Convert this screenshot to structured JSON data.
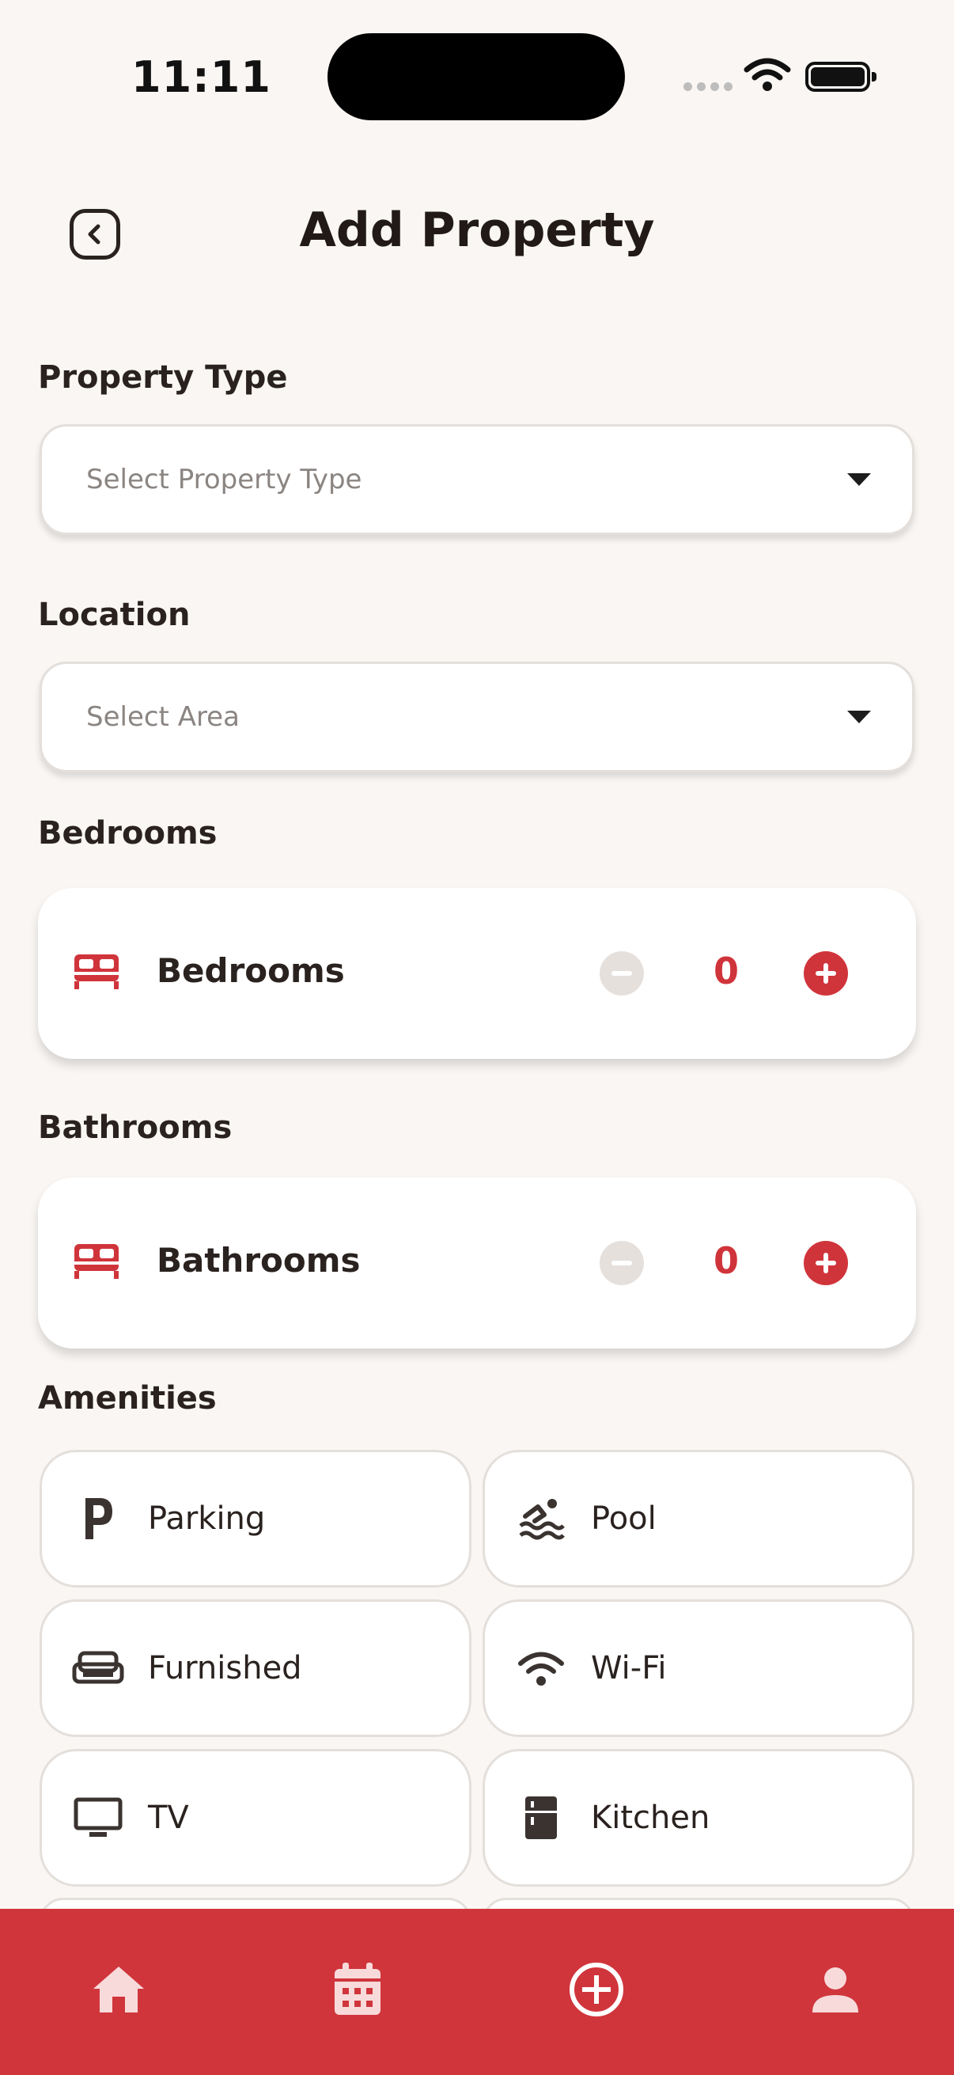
{
  "status_bar": {
    "time": "11:11"
  },
  "header": {
    "title": "Add Property",
    "back_icon": "chevron-left-icon"
  },
  "property_type": {
    "label": "Property Type",
    "placeholder": "Select Property Type"
  },
  "location": {
    "label": "Location",
    "placeholder": "Select Area"
  },
  "bedrooms": {
    "section_label": "Bedrooms",
    "card_label": "Bedrooms",
    "value": "0",
    "icon": "bed-icon"
  },
  "bathrooms": {
    "section_label": "Bathrooms",
    "card_label": "Bathrooms",
    "value": "0",
    "icon": "bed-icon"
  },
  "amenities": {
    "label": "Amenities",
    "items": [
      {
        "label": "Parking",
        "icon": "parking-icon"
      },
      {
        "label": "Pool",
        "icon": "swimming-icon"
      },
      {
        "label": "Furnished",
        "icon": "sofa-icon"
      },
      {
        "label": "Wi-Fi",
        "icon": "wifi-icon"
      },
      {
        "label": "TV",
        "icon": "tv-icon"
      },
      {
        "label": "Kitchen",
        "icon": "fridge-icon"
      }
    ]
  },
  "bottom_nav": {
    "items": [
      {
        "icon": "home-icon"
      },
      {
        "icon": "calendar-icon"
      },
      {
        "icon": "add-circle-icon"
      },
      {
        "icon": "profile-icon"
      }
    ]
  },
  "colors": {
    "accent": "#d0343b",
    "background": "#f9f6f3",
    "text": "#2a221f"
  }
}
